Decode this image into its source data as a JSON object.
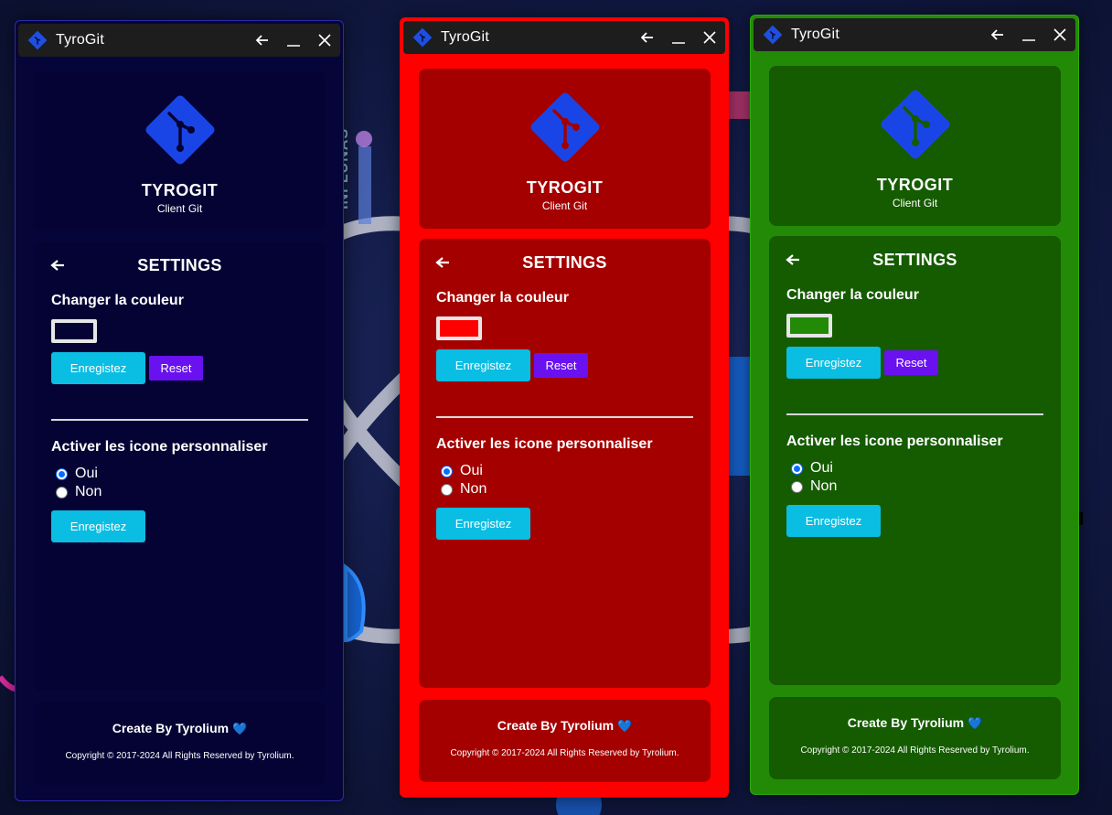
{
  "app": {
    "title": "TyroGit",
    "brand": "TYROGIT",
    "subtitle": "Client Git"
  },
  "settings": {
    "heading": "SETTINGS",
    "color_label": "Changer la couleur",
    "save_label": "Enregistez",
    "reset_label": "Reset",
    "icons_label": "Activer les icone personnaliser",
    "option_yes": "Oui",
    "option_no": "Non",
    "selected_option": "Oui"
  },
  "footer": {
    "title": "Create By Tyrolium",
    "heart": "💙",
    "copyright": "Copyright © 2017-2024 All Rights Reserved by Tyrolium."
  },
  "desktop": {
    "background_text": "INFLUNAS"
  },
  "windows": [
    {
      "theme": "dark-blue",
      "frame_color": "#06053a",
      "card_color": "#050334",
      "swatch_color": "#050334",
      "accent": "#0abde3"
    },
    {
      "theme": "red",
      "frame_color": "#ff0000",
      "card_color": "#a40000",
      "swatch_color": "#ff0000",
      "accent": "#0abde3"
    },
    {
      "theme": "green",
      "frame_color": "#238a08",
      "card_color": "#155b00",
      "swatch_color": "#238a08",
      "accent": "#0abde3"
    }
  ],
  "icons": {
    "back": "arrow-left-icon",
    "minimize": "minimize-icon",
    "close": "close-icon",
    "logo": "git-logo-icon",
    "heart": "heart-icon"
  }
}
